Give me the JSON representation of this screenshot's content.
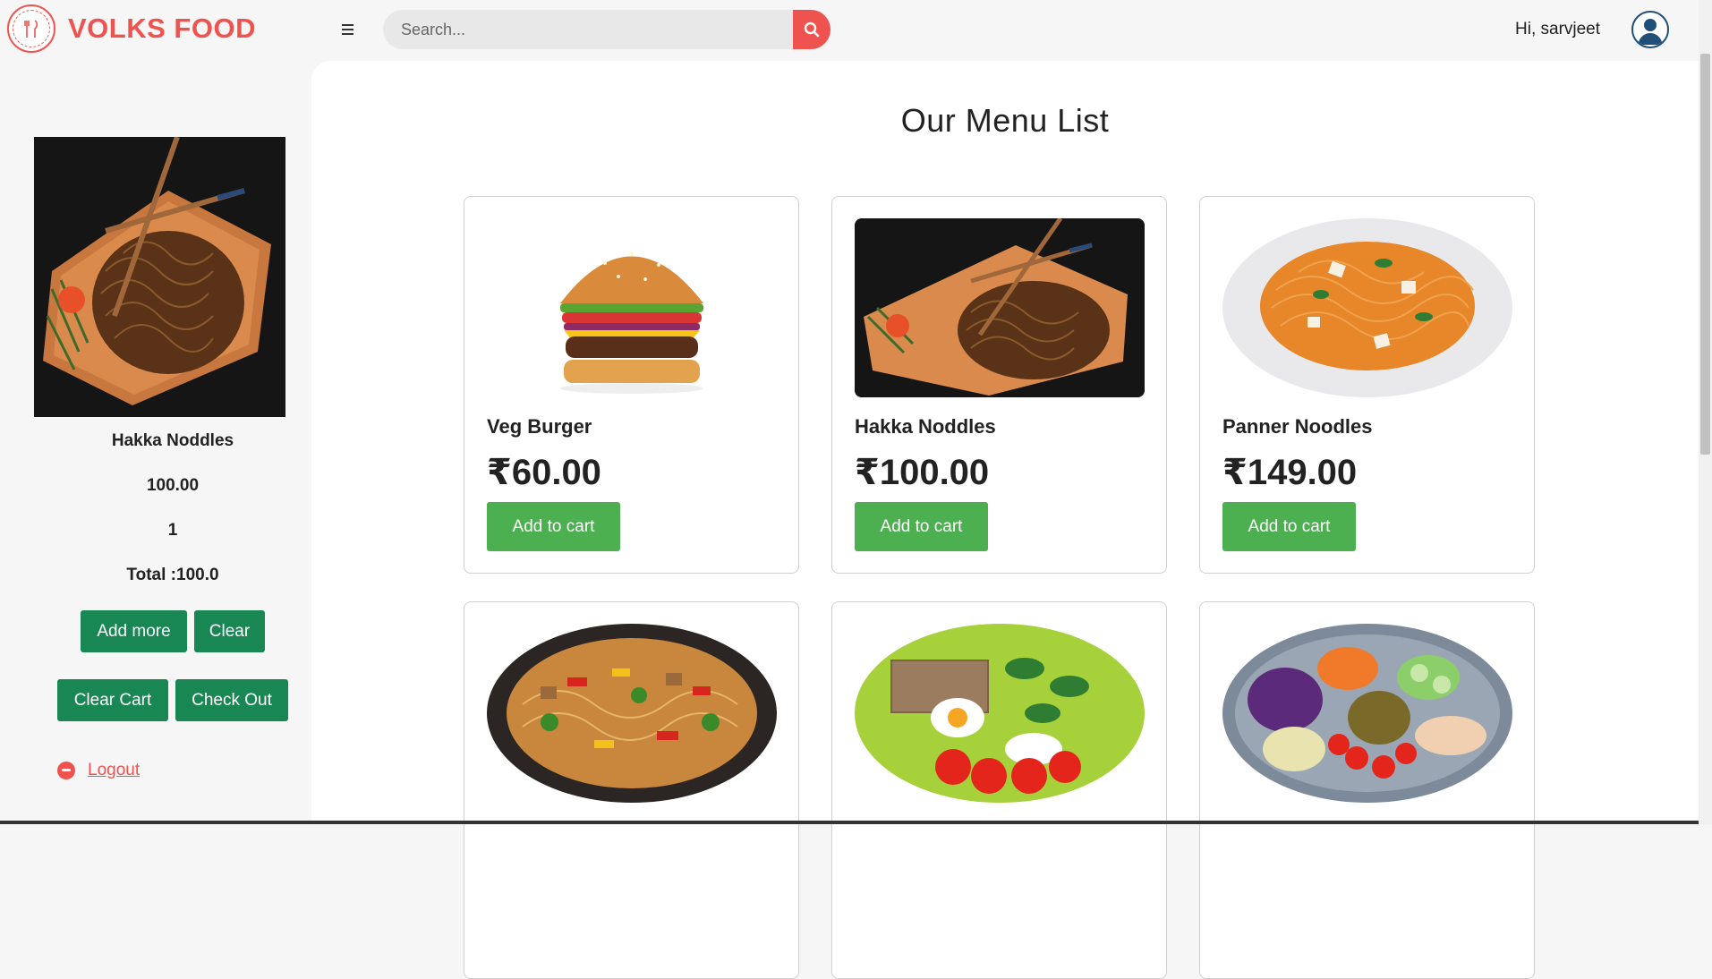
{
  "header": {
    "brand": "VOLKS FOOD",
    "search_placeholder": "Search...",
    "greeting": "Hi, sarvjeet"
  },
  "sidebar": {
    "item_name": "Hakka Noddles",
    "item_price": "100.00",
    "item_qty": "1",
    "total": "Total :100.0",
    "add_more": "Add more",
    "clear": "Clear",
    "clear_cart": "Clear Cart",
    "check_out": "Check Out",
    "logout": "Logout"
  },
  "main": {
    "title": "Our Menu List",
    "items": [
      {
        "name": "Veg Burger",
        "price": "₹60.00",
        "button": "Add to cart",
        "icon": "burger-image"
      },
      {
        "name": "Hakka Noddles",
        "price": "₹100.00",
        "button": "Add to cart",
        "icon": "noodles-image"
      },
      {
        "name": "Panner Noodles",
        "price": "₹149.00",
        "button": "Add to cart",
        "icon": "spaghetti-image"
      },
      {
        "icon": "stir-fry-noodles-image"
      },
      {
        "icon": "egg-salad-plate-image"
      },
      {
        "icon": "veggie-bowl-image"
      }
    ]
  },
  "colors": {
    "brand": "#ef5350",
    "sidebar_button": "#198754",
    "cart_button": "#4caf50"
  }
}
